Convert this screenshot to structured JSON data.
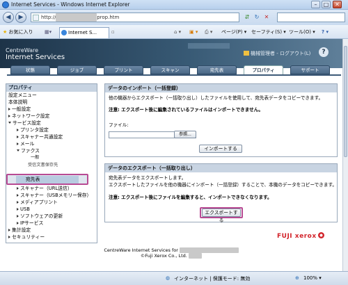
{
  "window": {
    "title": "Internet Services - Windows Internet Explorer",
    "minimize": "–",
    "maximize": "□",
    "close": "✕"
  },
  "browser": {
    "address": "http://",
    "address_tail": "prop.htm",
    "favorites_label": "お気に入り",
    "tab_label": "Internet S...",
    "commands": {
      "page": "ページ(P)",
      "safety": "セーフティ(S)",
      "tools": "ツール(O)",
      "help": "?"
    }
  },
  "header": {
    "brand_line1": "CentreWare",
    "brand_line2": "Internet Services",
    "admin_text": "機械管理者 - ログアウト(L)",
    "help": "?"
  },
  "tabs": [
    {
      "label": "状態"
    },
    {
      "label": "ジョブ"
    },
    {
      "label": "プリント"
    },
    {
      "label": "スキャン"
    },
    {
      "label": "宛先表"
    },
    {
      "label": "プロパティ"
    },
    {
      "label": "サポート"
    }
  ],
  "sidebar": {
    "title": "プロパティ",
    "items": [
      {
        "label": "設定メニュー"
      },
      {
        "label": "本体説明"
      },
      {
        "label": "一般設定"
      },
      {
        "label": "ネットワーク設定"
      },
      {
        "label": "サービス設定"
      },
      {
        "label": "プリンタ設定"
      },
      {
        "label": "スキャナー共通設定"
      },
      {
        "label": "メール"
      },
      {
        "label": "ファクス"
      },
      {
        "label": "一般"
      },
      {
        "label": "受信文書保存先"
      },
      {
        "label": "宛先表"
      },
      {
        "label": "スキャナー（URL送信）"
      },
      {
        "label": "スキャナー（USBメモリー保存）"
      },
      {
        "label": "メディアプリント"
      },
      {
        "label": "USB"
      },
      {
        "label": "ソフトウェアの更新"
      },
      {
        "label": "IPサービス"
      },
      {
        "label": "集計設定"
      },
      {
        "label": "セキュリティー"
      }
    ]
  },
  "import_panel": {
    "title": "データのインポート（一括登録）",
    "description": "他の機器からエクスポート（一括取り出し）したファイルを使用して、宛先表データをコピーできます。",
    "note": "注意: エクスポート後に編集されているファイルはインポートできません。",
    "file_label": "ファイル:",
    "browse_label": "参照...",
    "import_button": "インポートする"
  },
  "export_panel": {
    "title": "データのエクスポート（一括取り出し）",
    "description1": "宛先表データをエクスポートします。",
    "description2": "エクスポートしたファイルを他の機器にインポート（一括登録）することで、本機のデータをコピーできます。",
    "note": "注意: エクスポート後にファイルを編集すると、インポートできなくなります。",
    "export_button": "エクスポートする"
  },
  "footer": {
    "logo": "FUJI xerox",
    "line1_prefix": "CentreWare Internet Services for",
    "line2": "©Fuji Xerox Co., Ltd."
  },
  "statusbar": {
    "zone": "インターネット | 保護モード: 無効",
    "zoom": "100%"
  },
  "colors": {
    "accent": "#b84a93",
    "banner": "#1d3348",
    "tab": "#4a6886",
    "panel_head": "#c8d4e2"
  }
}
